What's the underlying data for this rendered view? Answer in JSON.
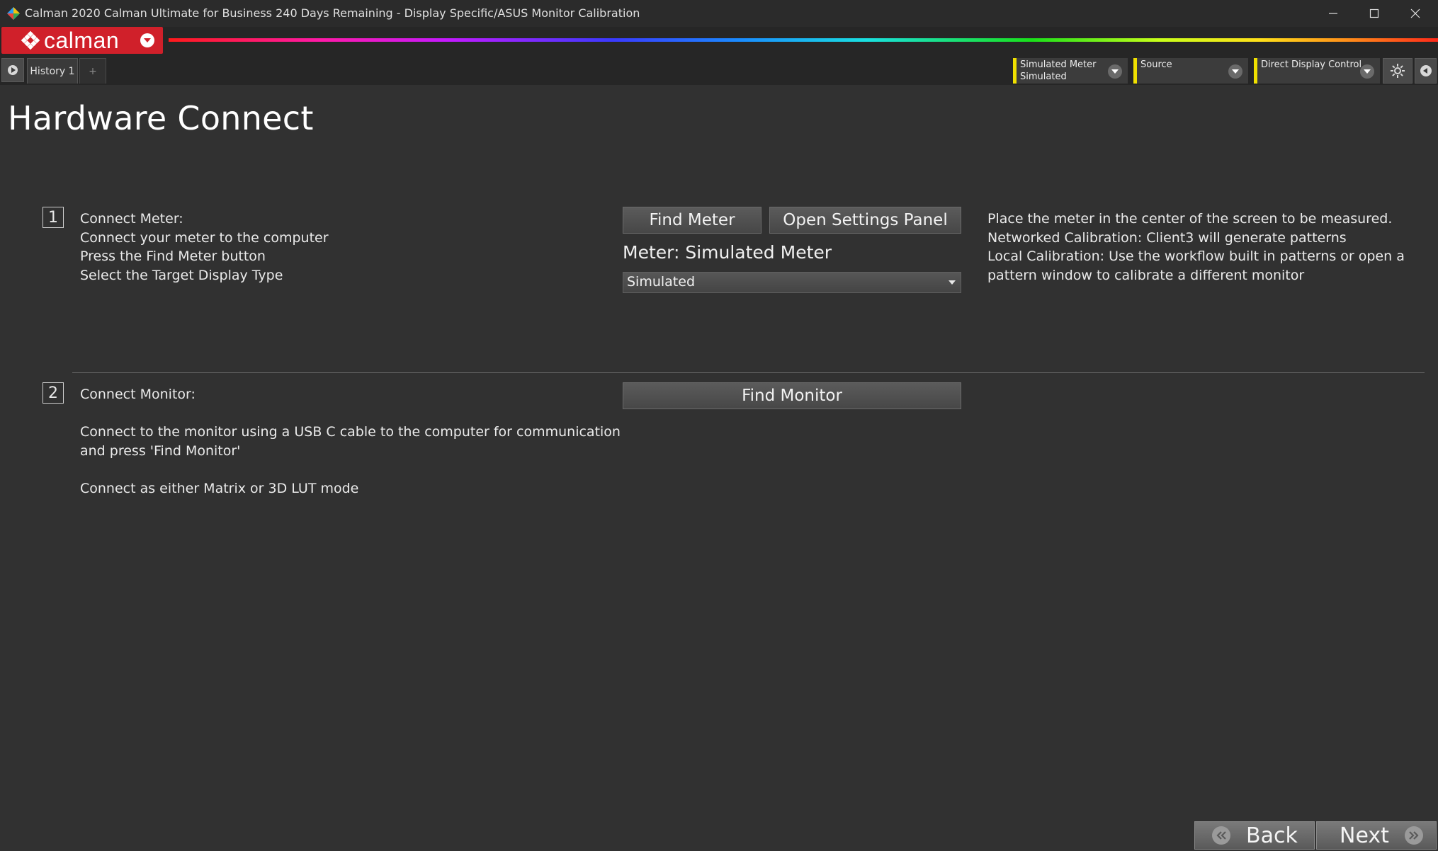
{
  "window": {
    "title": "Calman 2020 Calman Ultimate for Business 240 Days Remaining  -  Display Specific/ASUS Monitor Calibration"
  },
  "logo": {
    "text": "calman"
  },
  "tabs": [
    {
      "label": "History 1"
    }
  ],
  "tab_add_label": "+",
  "devices": [
    {
      "line1": "Simulated Meter",
      "line2": "Simulated"
    },
    {
      "line1": "Source",
      "line2": ""
    },
    {
      "line1": "Direct Display Control",
      "line2": ""
    }
  ],
  "page": {
    "title": "Hardware Connect"
  },
  "step1": {
    "number": "1",
    "lines": [
      "Connect Meter:",
      "Connect your meter to the computer",
      "Press the Find Meter button",
      "Select the Target Display Type"
    ],
    "find_meter_label": "Find Meter",
    "open_settings_label": "Open Settings Panel",
    "meter_label": "Meter: Simulated Meter",
    "display_type_value": "Simulated",
    "info_lines": [
      "Place the meter in the center of the screen to be measured.",
      "Networked Calibration: Client3 will generate patterns",
      "Local Calibration: Use the workflow built in patterns or open a",
      "pattern window to calibrate a different monitor"
    ]
  },
  "step2": {
    "number": "2",
    "lines": [
      "Connect Monitor:",
      "",
      "Connect to the monitor using a USB C cable to the computer for communication",
      "and press 'Find Monitor'",
      "",
      "Connect as either Matrix or 3D LUT mode"
    ],
    "find_monitor_label": "Find Monitor"
  },
  "nav": {
    "back_label": "Back",
    "next_label": "Next"
  },
  "colors": {
    "accent": "#d0202a",
    "device_marker": "#f0e000",
    "background": "#313131"
  }
}
